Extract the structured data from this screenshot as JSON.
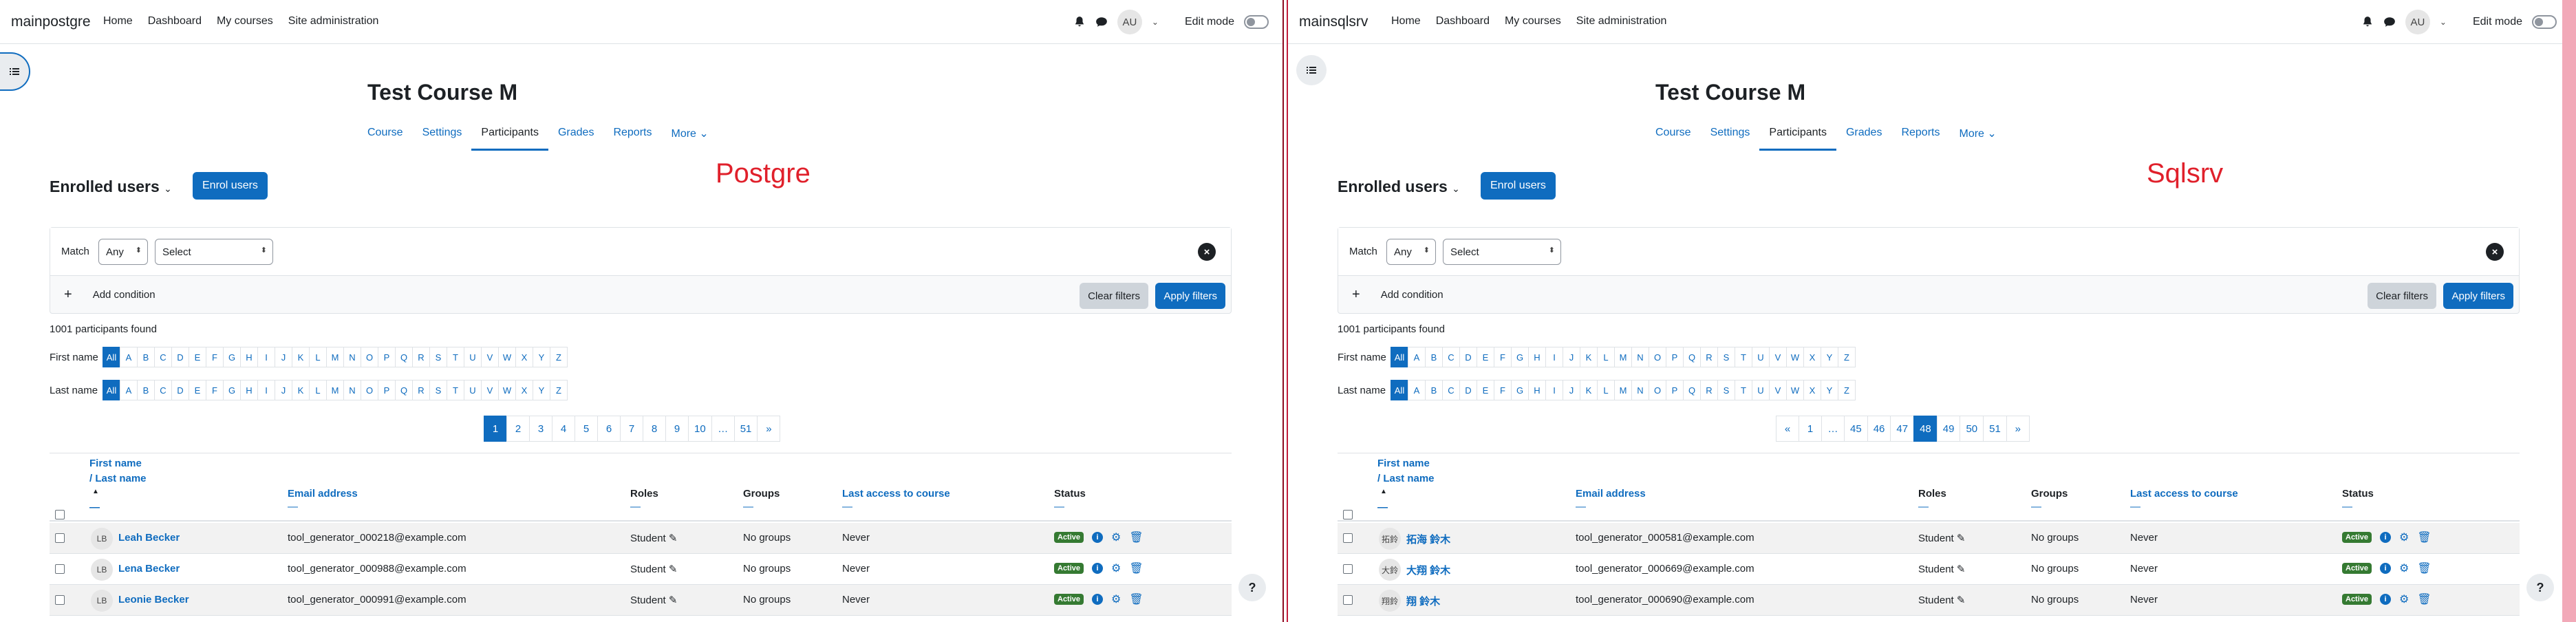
{
  "nav": {
    "links": [
      "Home",
      "Dashboard",
      "My courses",
      "Site administration"
    ],
    "avatar": "AU",
    "edit_mode": "Edit mode"
  },
  "course": {
    "title": "Test Course M",
    "tabs": [
      "Course",
      "Settings",
      "Participants",
      "Grades",
      "Reports",
      "More"
    ]
  },
  "participants": {
    "heading": "Enrolled users",
    "enrol_button": "Enrol users",
    "match_label": "Match",
    "match_value": "Any",
    "select_placeholder": "Select",
    "add_condition": "Add condition",
    "clear_filters": "Clear filters",
    "apply_filters": "Apply filters",
    "found": "1001 participants found",
    "firstname_label": "First name",
    "lastname_label": "Last name",
    "initials": [
      "All",
      "A",
      "B",
      "C",
      "D",
      "E",
      "F",
      "G",
      "H",
      "I",
      "J",
      "K",
      "L",
      "M",
      "N",
      "O",
      "P",
      "Q",
      "R",
      "S",
      "T",
      "U",
      "V",
      "W",
      "X",
      "Y",
      "Z"
    ],
    "columns": {
      "firstname": "First name",
      "lastname": "/ Last name",
      "email": "Email address",
      "roles": "Roles",
      "groups": "Groups",
      "lastaccess": "Last access to course",
      "status": "Status"
    }
  },
  "left": {
    "brand": "mainpostgre",
    "label": "Postgre",
    "pages": [
      "1",
      "2",
      "3",
      "4",
      "5",
      "6",
      "7",
      "8",
      "9",
      "10",
      "…",
      "51",
      "»"
    ],
    "current_page": "1",
    "rows": [
      {
        "initials": "LB",
        "name": "Leah Becker",
        "email": "tool_generator_000218@example.com",
        "role": "Student",
        "groups": "No groups",
        "access": "Never",
        "status": "Active"
      },
      {
        "initials": "LB",
        "name": "Lena Becker",
        "email": "tool_generator_000988@example.com",
        "role": "Student",
        "groups": "No groups",
        "access": "Never",
        "status": "Active"
      },
      {
        "initials": "LB",
        "name": "Leonie Becker",
        "email": "tool_generator_000991@example.com",
        "role": "Student",
        "groups": "No groups",
        "access": "Never",
        "status": "Active"
      }
    ]
  },
  "right": {
    "brand": "mainsqlsrv",
    "label": "Sqlsrv",
    "pages": [
      "«",
      "1",
      "…",
      "45",
      "46",
      "47",
      "48",
      "49",
      "50",
      "51",
      "»"
    ],
    "current_page": "48",
    "rows": [
      {
        "initials": "拓鈴",
        "name": "拓海 鈴木",
        "email": "tool_generator_000581@example.com",
        "role": "Student",
        "groups": "No groups",
        "access": "Never",
        "status": "Active"
      },
      {
        "initials": "大鈴",
        "name": "大翔 鈴木",
        "email": "tool_generator_000669@example.com",
        "role": "Student",
        "groups": "No groups",
        "access": "Never",
        "status": "Active"
      },
      {
        "initials": "翔鈴",
        "name": "翔 鈴木",
        "email": "tool_generator_000690@example.com",
        "role": "Student",
        "groups": "No groups",
        "access": "Never",
        "status": "Active"
      }
    ]
  },
  "colors": {
    "primary": "#0f6cbf",
    "active_badge": "#357a32",
    "label": "#e0202b"
  }
}
